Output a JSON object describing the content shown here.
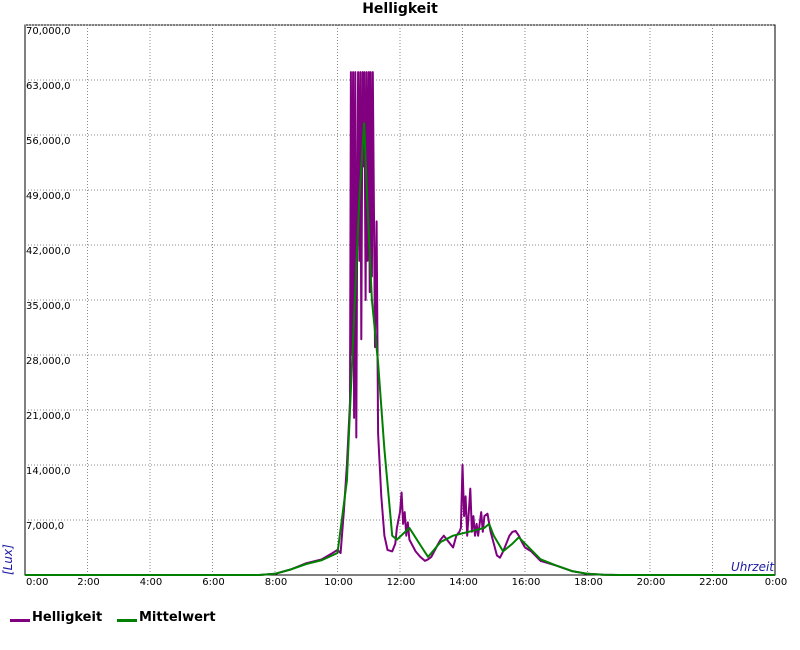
{
  "chart_data": {
    "type": "line",
    "title": "Helligkeit",
    "xlabel": "Uhrzeit",
    "ylabel": "[Lux]",
    "x_unit": "hours",
    "xlim": [
      0,
      24
    ],
    "ylim": [
      0,
      70000
    ],
    "x_ticks": [
      0,
      2,
      4,
      6,
      8,
      10,
      12,
      14,
      16,
      18,
      20,
      22,
      24
    ],
    "x_tick_labels": [
      "0:00",
      "2:00",
      "4:00",
      "6:00",
      "8:00",
      "10:00",
      "12:00",
      "14:00",
      "16:00",
      "18:00",
      "20:00",
      "22:00",
      "0:00"
    ],
    "y_ticks": [
      0,
      7000,
      14000,
      21000,
      28000,
      35000,
      42000,
      49000,
      56000,
      63000,
      70000
    ],
    "y_tick_labels": [
      "0,00",
      "7,000,0",
      "14,000,0",
      "21,000,0",
      "28,000,0",
      "35,000,0",
      "42,000,0",
      "49,000,0",
      "56,000,0",
      "63,000,0",
      "70,000,0"
    ],
    "grid": true,
    "legend_position": "bottom-left",
    "series": [
      {
        "name": "Helligkeit",
        "color": "#800080",
        "points": [
          [
            0,
            0
          ],
          [
            7.5,
            0
          ],
          [
            8.0,
            150
          ],
          [
            8.5,
            700
          ],
          [
            9.0,
            1500
          ],
          [
            9.5,
            2000
          ],
          [
            9.8,
            2700
          ],
          [
            10.0,
            3200
          ],
          [
            10.1,
            2800
          ],
          [
            10.2,
            8000
          ],
          [
            10.3,
            14000
          ],
          [
            10.4,
            22000
          ],
          [
            10.43,
            64000
          ],
          [
            10.46,
            28000
          ],
          [
            10.5,
            64000
          ],
          [
            10.53,
            20000
          ],
          [
            10.57,
            64000
          ],
          [
            10.6,
            17500
          ],
          [
            10.63,
            45000
          ],
          [
            10.66,
            64000
          ],
          [
            10.7,
            40000
          ],
          [
            10.73,
            64000
          ],
          [
            10.76,
            30000
          ],
          [
            10.8,
            64000
          ],
          [
            10.83,
            52000
          ],
          [
            10.86,
            64000
          ],
          [
            10.9,
            35000
          ],
          [
            10.93,
            64000
          ],
          [
            10.96,
            40000
          ],
          [
            11.0,
            64000
          ],
          [
            11.03,
            36000
          ],
          [
            11.06,
            64000
          ],
          [
            11.1,
            38000
          ],
          [
            11.13,
            64000
          ],
          [
            11.17,
            44000
          ],
          [
            11.2,
            29000
          ],
          [
            11.25,
            45000
          ],
          [
            11.3,
            18000
          ],
          [
            11.4,
            10000
          ],
          [
            11.5,
            5000
          ],
          [
            11.6,
            3200
          ],
          [
            11.75,
            3000
          ],
          [
            11.85,
            4000
          ],
          [
            11.9,
            6000
          ],
          [
            12.0,
            8000
          ],
          [
            12.05,
            10500
          ],
          [
            12.1,
            6500
          ],
          [
            12.15,
            8000
          ],
          [
            12.2,
            5000
          ],
          [
            12.25,
            6700
          ],
          [
            12.3,
            4500
          ],
          [
            12.5,
            3000
          ],
          [
            12.65,
            2300
          ],
          [
            12.8,
            1800
          ],
          [
            12.9,
            2000
          ],
          [
            13.0,
            2300
          ],
          [
            13.2,
            3800
          ],
          [
            13.3,
            4500
          ],
          [
            13.4,
            5000
          ],
          [
            13.5,
            4500
          ],
          [
            13.6,
            4000
          ],
          [
            13.7,
            3500
          ],
          [
            13.8,
            5000
          ],
          [
            13.9,
            5500
          ],
          [
            13.95,
            6000
          ],
          [
            14.0,
            14000
          ],
          [
            14.05,
            7500
          ],
          [
            14.1,
            10000
          ],
          [
            14.15,
            5000
          ],
          [
            14.2,
            8000
          ],
          [
            14.25,
            11000
          ],
          [
            14.3,
            5500
          ],
          [
            14.35,
            7500
          ],
          [
            14.4,
            5000
          ],
          [
            14.45,
            6500
          ],
          [
            14.5,
            5000
          ],
          [
            14.6,
            8000
          ],
          [
            14.65,
            5500
          ],
          [
            14.7,
            7500
          ],
          [
            14.8,
            7800
          ],
          [
            14.9,
            5500
          ],
          [
            15.0,
            4000
          ],
          [
            15.1,
            2500
          ],
          [
            15.2,
            2200
          ],
          [
            15.3,
            3000
          ],
          [
            15.4,
            4000
          ],
          [
            15.5,
            5000
          ],
          [
            15.6,
            5500
          ],
          [
            15.7,
            5600
          ],
          [
            15.8,
            5000
          ],
          [
            15.9,
            4200
          ],
          [
            16.0,
            3500
          ],
          [
            16.2,
            3000
          ],
          [
            16.5,
            1800
          ],
          [
            17.0,
            1200
          ],
          [
            17.5,
            500
          ],
          [
            18.0,
            150
          ],
          [
            18.5,
            30
          ],
          [
            19.0,
            0
          ],
          [
            24,
            0
          ]
        ]
      },
      {
        "name": "Mittelwert",
        "color": "#008000",
        "points": [
          [
            0,
            0
          ],
          [
            7.5,
            0
          ],
          [
            8.0,
            150
          ],
          [
            8.5,
            700
          ],
          [
            9.0,
            1400
          ],
          [
            9.5,
            1900
          ],
          [
            10.0,
            2800
          ],
          [
            10.3,
            12000
          ],
          [
            10.5,
            30000
          ],
          [
            10.7,
            48000
          ],
          [
            10.85,
            57500
          ],
          [
            10.95,
            48000
          ],
          [
            11.1,
            35000
          ],
          [
            11.3,
            27000
          ],
          [
            11.5,
            16000
          ],
          [
            11.75,
            5000
          ],
          [
            11.9,
            4500
          ],
          [
            12.3,
            6000
          ],
          [
            12.7,
            3500
          ],
          [
            12.9,
            2300
          ],
          [
            13.3,
            4200
          ],
          [
            13.7,
            5000
          ],
          [
            14.2,
            5500
          ],
          [
            14.7,
            6000
          ],
          [
            14.85,
            6500
          ],
          [
            15.0,
            5000
          ],
          [
            15.3,
            3000
          ],
          [
            15.6,
            4000
          ],
          [
            15.8,
            4800
          ],
          [
            16.0,
            4000
          ],
          [
            16.5,
            2000
          ],
          [
            17.0,
            1200
          ],
          [
            17.5,
            500
          ],
          [
            18.0,
            150
          ],
          [
            18.5,
            30
          ],
          [
            19.0,
            0
          ],
          [
            24,
            0
          ]
        ]
      }
    ]
  }
}
